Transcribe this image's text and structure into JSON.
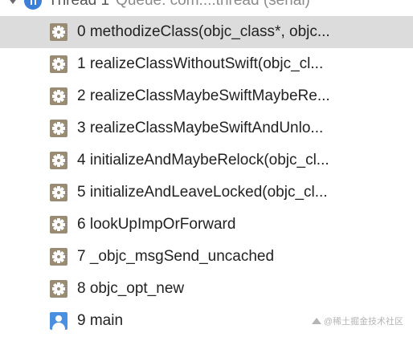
{
  "thread": {
    "name": "Thread 1",
    "queue": "Queue: com....thread (serial)"
  },
  "frames": [
    {
      "label": "0 methodizeClass(objc_class*, objc...",
      "icon": "gear-icon",
      "selected": true
    },
    {
      "label": "1 realizeClassWithoutSwift(objc_cl...",
      "icon": "gear-icon",
      "selected": false
    },
    {
      "label": "2 realizeClassMaybeSwiftMaybeRe...",
      "icon": "gear-icon",
      "selected": false
    },
    {
      "label": "3 realizeClassMaybeSwiftAndUnlo...",
      "icon": "gear-icon",
      "selected": false
    },
    {
      "label": "4 initializeAndMaybeRelock(objc_cl...",
      "icon": "gear-icon",
      "selected": false
    },
    {
      "label": "5 initializeAndLeaveLocked(objc_cl...",
      "icon": "gear-icon",
      "selected": false
    },
    {
      "label": "6 lookUpImpOrForward",
      "icon": "gear-icon",
      "selected": false
    },
    {
      "label": "7 _objc_msgSend_uncached",
      "icon": "gear-icon",
      "selected": false
    },
    {
      "label": "8 objc_opt_new",
      "icon": "gear-icon",
      "selected": false
    },
    {
      "label": "9 main",
      "icon": "user-icon",
      "selected": false
    }
  ],
  "watermark": {
    "text": "@稀土掘金技术社区"
  },
  "colors": {
    "selected_row": "#dcdcdc",
    "system_frame_icon": "#9a8b75",
    "user_frame_icon": "#4a8fe0",
    "thread_icon": "#3b7fd6"
  }
}
